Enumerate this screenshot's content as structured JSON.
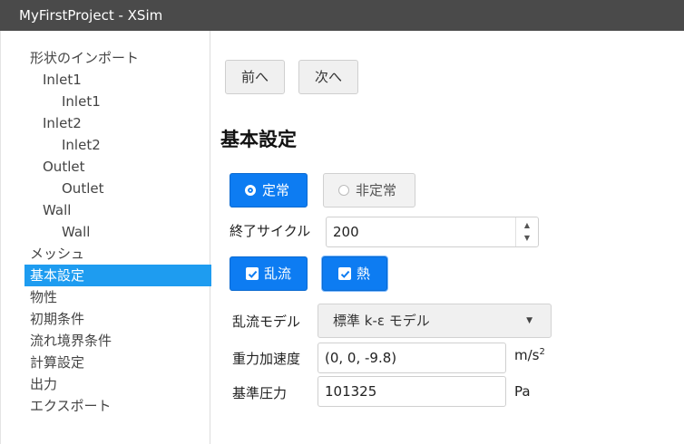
{
  "window": {
    "title": "MyFirstProject - XSim"
  },
  "sidebar": {
    "items": [
      {
        "label": "形状のインポート",
        "level": 0
      },
      {
        "label": "Inlet1",
        "level": 1
      },
      {
        "label": "Inlet1",
        "level": 2
      },
      {
        "label": "Inlet2",
        "level": 1
      },
      {
        "label": "Inlet2",
        "level": 2
      },
      {
        "label": "Outlet",
        "level": 1
      },
      {
        "label": "Outlet",
        "level": 2
      },
      {
        "label": "Wall",
        "level": 1
      },
      {
        "label": "Wall",
        "level": 2
      },
      {
        "label": "メッシュ",
        "level": 0
      },
      {
        "label": "基本設定",
        "level": 0,
        "selected": true
      },
      {
        "label": "物性",
        "level": 0
      },
      {
        "label": "初期条件",
        "level": 0
      },
      {
        "label": "流れ境界条件",
        "level": 0
      },
      {
        "label": "計算設定",
        "level": 0
      },
      {
        "label": "出力",
        "level": 0
      },
      {
        "label": "エクスポート",
        "level": 0
      }
    ]
  },
  "nav": {
    "prev_label": "前へ",
    "next_label": "次へ"
  },
  "section": {
    "title": "基本設定"
  },
  "time_mode": {
    "steady_label": "定常",
    "unsteady_label": "非定常",
    "selected": "定常"
  },
  "end_cycle": {
    "label": "終了サイクル",
    "value": "200"
  },
  "options": {
    "turbulence_label": "乱流",
    "turbulence_checked": true,
    "heat_label": "熱",
    "heat_checked": true
  },
  "turbulence_model": {
    "label": "乱流モデル",
    "selected": "標準 k-ε モデル"
  },
  "gravity": {
    "label": "重力加速度",
    "value": "(0, 0, -9.8)",
    "unit_base": "m/s",
    "unit_exp": "2"
  },
  "ref_pressure": {
    "label": "基準圧力",
    "value": "101325",
    "unit": "Pa"
  },
  "colors": {
    "accent": "#0d7cf2",
    "selection": "#1e9cf0",
    "titlebar": "#4a4a4a"
  }
}
